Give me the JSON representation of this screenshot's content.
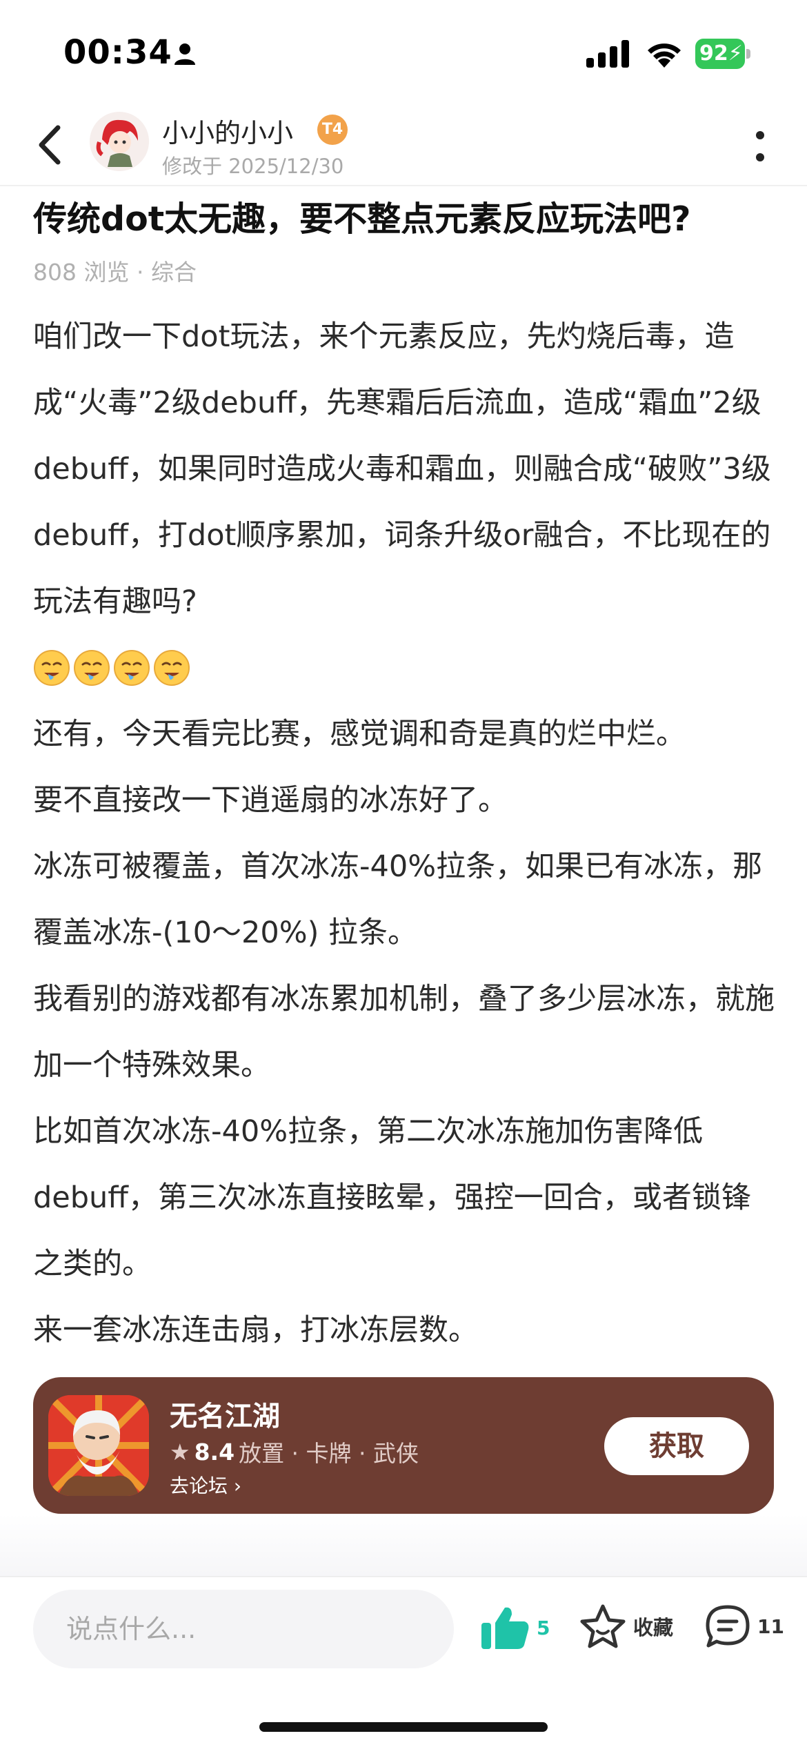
{
  "status_bar": {
    "time": "00:34",
    "battery": "92"
  },
  "header": {
    "author_name": "小小的小小",
    "level_badge": "T4",
    "edit_time": "修改于 2025/12/30"
  },
  "post": {
    "title": "传统dot太无趣，要不整点元素反应玩法吧?",
    "meta": "808 浏览 · 综合",
    "paragraph_1": "咱们改一下dot玩法，来个元素反应，先灼烧后毒，造成“火毒”2级debuff，先寒霜后后流血，造成“霜血”2级debuff，如果同时造成火毒和霜血，则融合成“破败”3级debuff，打dot顺序累加，词条升级or融合，不比现在的玩法有趣吗?",
    "emojis": [
      "drooling-face-icon",
      "drooling-face-icon",
      "drooling-face-icon",
      "drooling-face-icon"
    ],
    "paragraph_2": "还有，今天看完比赛，感觉调和奇是真的烂中烂。",
    "paragraph_3": "要不直接改一下逍遥扇的冰冻好了。",
    "paragraph_4": "冰冻可被覆盖，首次冰冻-40%拉条，如果已有冰冻，那覆盖冰冻-(10～20%) 拉条。",
    "paragraph_5": "我看别的游戏都有冰冻累加机制，叠了多少层冰冻，就施加一个特殊效果。",
    "paragraph_6": "比如首次冰冻-40%拉条，第二次冰冻施加伤害降低debuff，第三次冰冻直接眩晕，强控一回合，或者锁锋之类的。",
    "paragraph_7": "来一套冰冻连击扇，打冰冻层数。"
  },
  "app_card": {
    "name": "无名江湖",
    "rating": "8.4",
    "tags": "放置 · 卡牌 · 武侠",
    "forum_link": "去论坛",
    "get_label": "获取",
    "background_color": "#6e3d32"
  },
  "bottom_bar": {
    "comment_placeholder": "说点什么...",
    "like_count": "5",
    "favorite_label": "收藏",
    "comment_count": "11",
    "accent_color": "#1fc3a8"
  }
}
